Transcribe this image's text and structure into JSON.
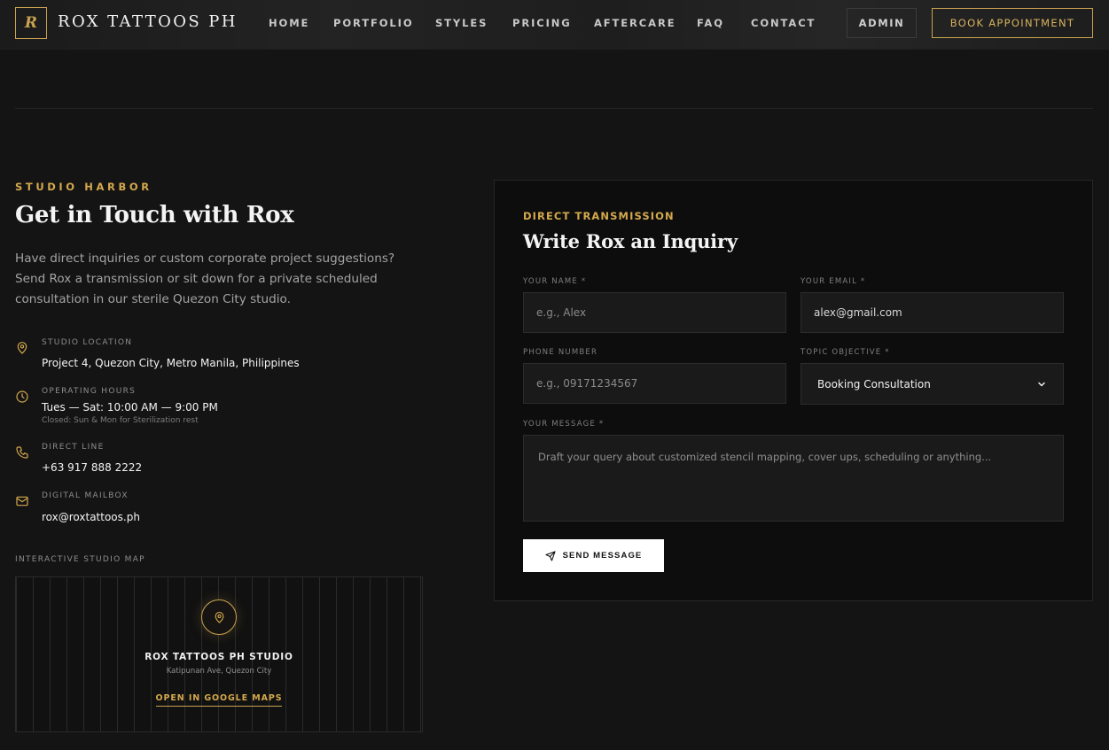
{
  "nav": {
    "logo_letter": "R",
    "brand": "ROX TATTOOS PH",
    "links": [
      "HOME",
      "PORTFOLIO",
      "STYLES",
      "PRICING",
      "AFTERCARE",
      "FAQ",
      "CONTACT"
    ],
    "admin_label": "ADMIN",
    "book_label": "BOOK APPOINTMENT"
  },
  "contact": {
    "eyebrow": "STUDIO HARBOR",
    "title": "Get in Touch with Rox",
    "intro": "Have direct inquiries or custom corporate project suggestions? Send Rox a transmission or sit down for a private scheduled consultation in our sterile Quezon City studio.",
    "location": {
      "icon": "map-pin-icon",
      "label": "STUDIO LOCATION",
      "value": "Project 4, Quezon City, Metro Manila, Philippines"
    },
    "hours": {
      "icon": "clock-icon",
      "label": "OPERATING HOURS",
      "value": "Tues — Sat: 10:00 AM — 9:00 PM",
      "note": "Closed: Sun & Mon for Sterilization rest"
    },
    "phone": {
      "icon": "phone-icon",
      "label": "DIRECT LINE",
      "value": "+63 917 888 2222"
    },
    "email": {
      "icon": "mail-icon",
      "label": "DIGITAL MAILBOX",
      "value": "rox@roxtattoos.ph"
    },
    "map": {
      "label": "INTERACTIVE STUDIO MAP",
      "title": "ROX TATTOOS PH STUDIO",
      "subtitle": "Katipunan Ave, Quezon City",
      "link": "OPEN IN GOOGLE MAPS"
    }
  },
  "form": {
    "eyebrow": "DIRECT TRANSMISSION",
    "title": "Write Rox an Inquiry",
    "name": {
      "label": "YOUR NAME *",
      "placeholder": "e.g., Alex",
      "value": ""
    },
    "email": {
      "label": "YOUR EMAIL *",
      "placeholder": "",
      "value": "alex@gmail.com"
    },
    "phone": {
      "label": "PHONE NUMBER",
      "placeholder": "e.g., 09171234567",
      "value": ""
    },
    "topic": {
      "label": "TOPIC OBJECTIVE *",
      "selected": "Booking Consultation"
    },
    "message": {
      "label": "YOUR MESSAGE *",
      "placeholder": "Draft your query about customized stencil mapping, cover ups, scheduling or anything..."
    },
    "send_label": "SEND MESSAGE"
  },
  "colors": {
    "accent": "#d4a94d",
    "background": "#141414",
    "panel": "#0d0d0d",
    "field": "#1a1a1a"
  }
}
